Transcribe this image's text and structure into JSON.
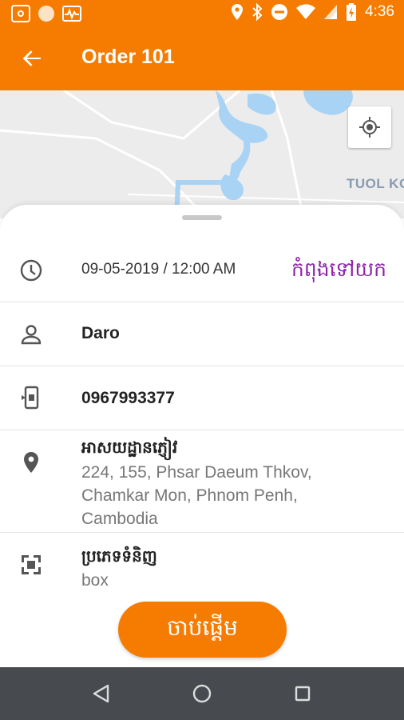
{
  "status_bar": {
    "time": "4:36"
  },
  "app_bar": {
    "title": "Order 101"
  },
  "map": {
    "district_label": "TUOL KO"
  },
  "order": {
    "datetime": "09-05-2019 / 12:00 AM",
    "status": "កំពុងទៅយក",
    "customer_name": "Daro",
    "phone": "0967993377",
    "address_title": "អាសយដ្ឋានភ្ញៀវ",
    "address": "224, 155, Phsar Daeum Thkov, Chamkar Mon, Phnom Penh, Cambodia",
    "goods_title": "ប្រភេទទំនិញ",
    "goods_type": "box"
  },
  "actions": {
    "start_label": "ចាប់ផ្តើម"
  },
  "colors": {
    "primary": "#f57c00",
    "status_text": "#8e24aa",
    "nav_bar": "#474b4f"
  },
  "icons": {
    "back": "arrow-left-icon",
    "locate": "my-location-icon",
    "time": "clock-icon",
    "person": "person-icon",
    "phone": "phone-icon",
    "location": "location-pin-icon",
    "goods": "package-icon"
  }
}
